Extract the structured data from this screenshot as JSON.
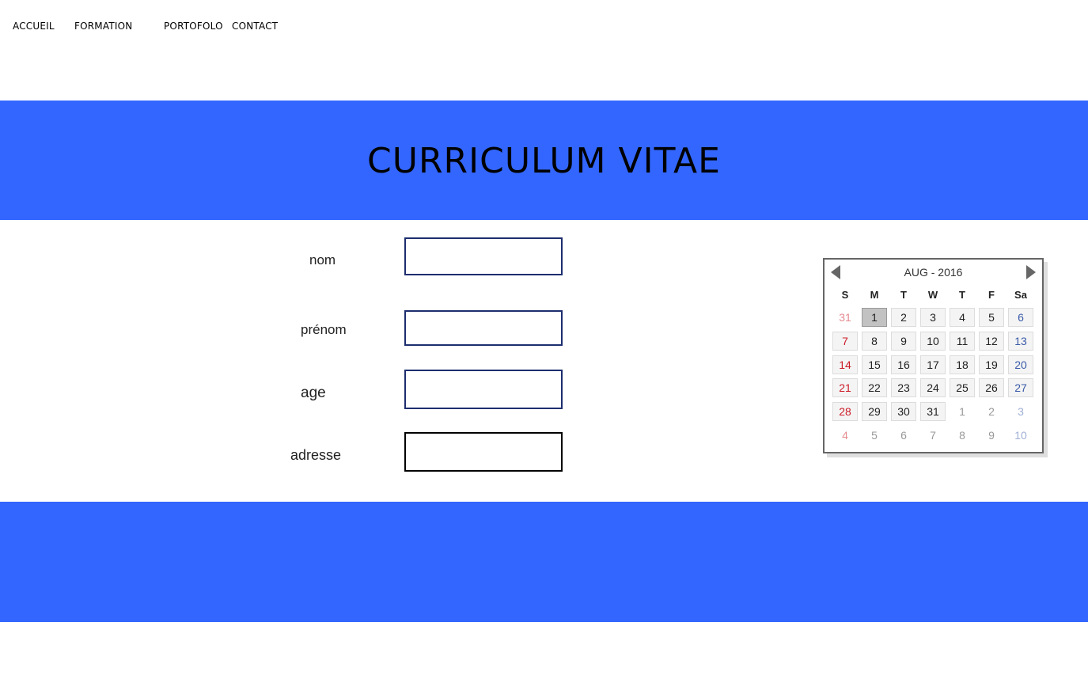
{
  "nav": {
    "accueil": "ACCUEIL",
    "formation": "FORMATION",
    "portofolo": "PORTOFOLO",
    "contact": "CONTACT"
  },
  "header": {
    "title": "CURRICULUM VITAE"
  },
  "form": {
    "nom_label": "nom",
    "prenom_label": "prénom",
    "age_label": "age",
    "adresse_label": "adresse"
  },
  "calendar": {
    "title": "AUG - 2016",
    "weekdays": [
      "S",
      "M",
      "T",
      "W",
      "T",
      "F",
      "Sa"
    ],
    "selected_day": "1",
    "weeks": [
      [
        "31",
        "1",
        "2",
        "3",
        "4",
        "5",
        "6"
      ],
      [
        "7",
        "8",
        "9",
        "10",
        "11",
        "12",
        "13"
      ],
      [
        "14",
        "15",
        "16",
        "17",
        "18",
        "19",
        "20"
      ],
      [
        "21",
        "22",
        "23",
        "24",
        "25",
        "26",
        "27"
      ],
      [
        "28",
        "29",
        "30",
        "31",
        "1",
        "2",
        "3"
      ],
      [
        "4",
        "5",
        "6",
        "7",
        "8",
        "9",
        "10"
      ]
    ]
  },
  "colors": {
    "banner": "#3366ff",
    "field_border": "#1d2e6e",
    "sunday": "#cc1c28",
    "saturday": "#3a5aa8"
  }
}
